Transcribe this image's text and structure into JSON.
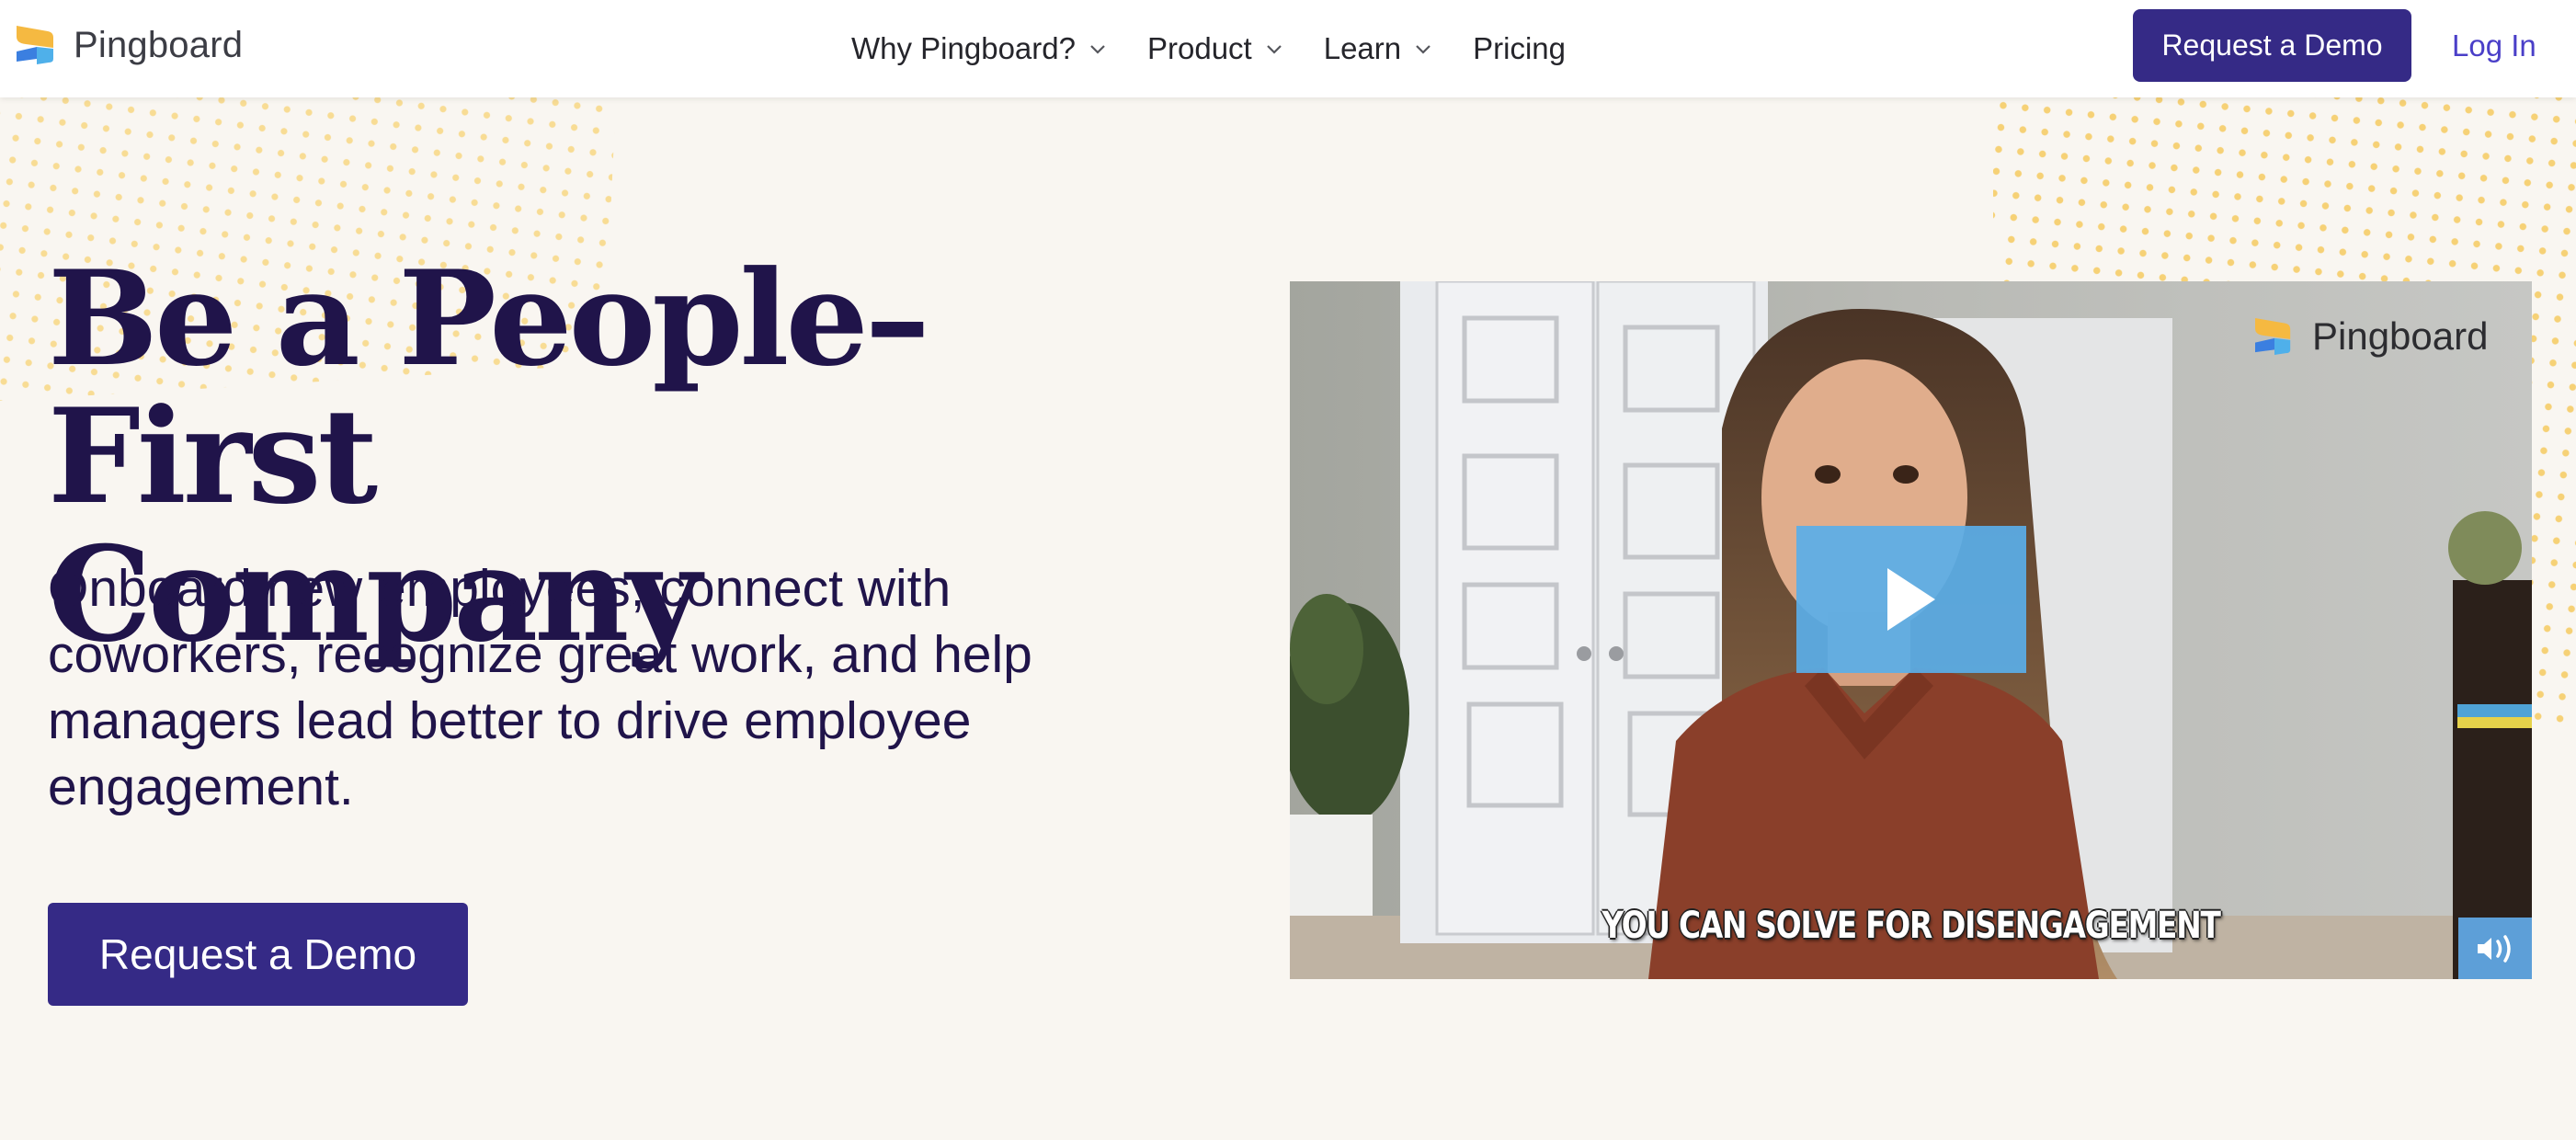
{
  "header": {
    "brand_name": "Pingboard",
    "nav": [
      {
        "label": "Why Pingboard?",
        "has_dropdown": true
      },
      {
        "label": "Product",
        "has_dropdown": true
      },
      {
        "label": "Learn",
        "has_dropdown": true
      },
      {
        "label": "Pricing",
        "has_dropdown": false
      }
    ],
    "cta_label": "Request a Demo",
    "login_label": "Log In"
  },
  "hero": {
    "title_line1": "Be a People–First",
    "title_line2": "Company",
    "subtitle": "Onboard new employees, connect with coworkers, recognize great work, and help managers lead better to drive employee engagement.",
    "cta_label": "Request a Demo"
  },
  "video": {
    "watermark_brand": "Pingboard",
    "caption": "YOU CAN SOLVE FOR DISENGAGEMENT",
    "play_icon": "play-icon",
    "volume_icon": "volume-icon"
  },
  "colors": {
    "brand_primary": "#352a86",
    "login_link": "#4a3fc8",
    "heading_text": "#20144a",
    "page_background": "#f9f6f1",
    "dot_pattern": "#f6d176",
    "play_button": "#5aaee8",
    "volume_button": "#5d9fd8",
    "logo_yellow": "#f5b941",
    "logo_blue": "#3b7fe0",
    "logo_light_blue": "#4fb0ea"
  }
}
